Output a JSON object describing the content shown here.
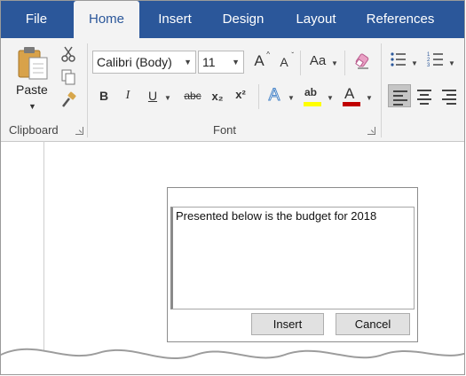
{
  "tabs": [
    {
      "label": "File",
      "active": false
    },
    {
      "label": "Home",
      "active": true
    },
    {
      "label": "Insert",
      "active": false
    },
    {
      "label": "Design",
      "active": false
    },
    {
      "label": "Layout",
      "active": false
    },
    {
      "label": "References",
      "active": false
    }
  ],
  "ribbon": {
    "clipboard": {
      "paste_label": "Paste",
      "group_label": "Clipboard"
    },
    "font": {
      "font_name": "Calibri (Body)",
      "font_size": "11",
      "change_case_label": "Aa",
      "bold_label": "B",
      "italic_label": "I",
      "underline_label": "U",
      "strikethrough_label": "abc",
      "subscript_label": "x₂",
      "superscript_label": "x²",
      "group_label": "Font",
      "grow_label": "A",
      "shrink_label": "A",
      "font_color_label": "A",
      "highlight_label": "ab",
      "text_effects_label": "A"
    },
    "colors": {
      "accent": "#2b579a",
      "highlight": "#ffff00",
      "font_color": "#c00000",
      "text_effects": "#4a86c8"
    }
  },
  "dialog": {
    "text_value": "Presented below is the budget for 2018",
    "insert_label": "Insert",
    "cancel_label": "Cancel"
  }
}
